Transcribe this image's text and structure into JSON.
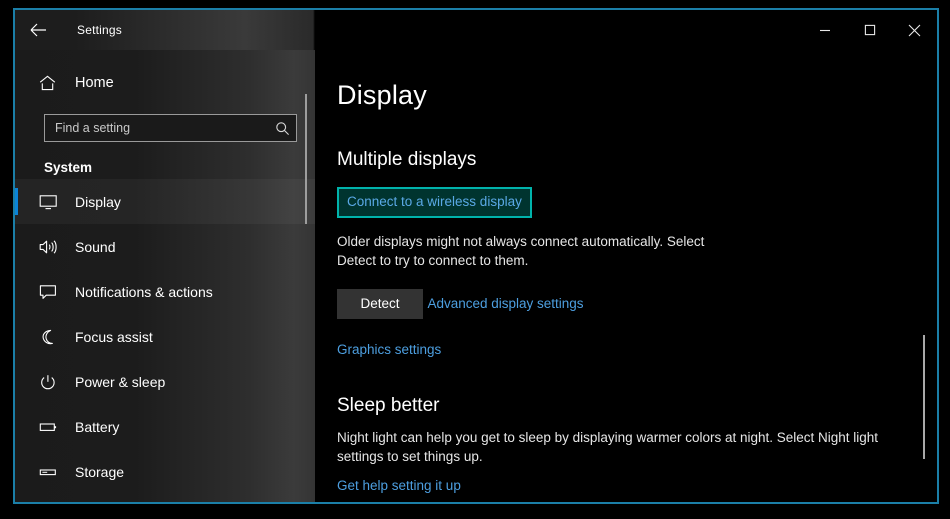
{
  "window": {
    "titlebar": {
      "back_label": "Back",
      "title": "Settings",
      "minimize_label": "Minimize",
      "maximize_label": "Maximize",
      "close_label": "Close"
    },
    "border_color": "#1b7fa8"
  },
  "sidebar": {
    "home": {
      "label": "Home",
      "icon": "home-icon"
    },
    "search": {
      "placeholder": "Find a setting",
      "value": "",
      "icon": "search-icon"
    },
    "group_title": "System",
    "items": [
      {
        "label": "Display",
        "icon": "monitor-icon",
        "selected": true
      },
      {
        "label": "Sound",
        "icon": "speaker-icon",
        "selected": false
      },
      {
        "label": "Notifications & actions",
        "icon": "chat-bubble-icon",
        "selected": false
      },
      {
        "label": "Focus assist",
        "icon": "moon-icon",
        "selected": false
      },
      {
        "label": "Power & sleep",
        "icon": "power-icon",
        "selected": false
      },
      {
        "label": "Battery",
        "icon": "battery-icon",
        "selected": false
      },
      {
        "label": "Storage",
        "icon": "drive-icon",
        "selected": false
      }
    ],
    "accent_color": "#0a84d8"
  },
  "content": {
    "page_title": "Display",
    "multiple_displays": {
      "heading": "Multiple displays",
      "wireless_link": "Connect to a wireless display",
      "highlight_border_color": "#00b3ab",
      "highlight_fill_color": "#00342f",
      "description": "Older displays might not always connect automatically. Select Detect to try to connect to them.",
      "detect_button": "Detect",
      "advanced_link": "Advanced display settings",
      "graphics_link": "Graphics settings"
    },
    "sleep_better": {
      "heading": "Sleep better",
      "description": "Night light can help you get to sleep by displaying warmer colors at night. Select Night light settings to set things up.",
      "help_link": "Get help setting it up"
    },
    "link_color": "#4d9fe0"
  }
}
